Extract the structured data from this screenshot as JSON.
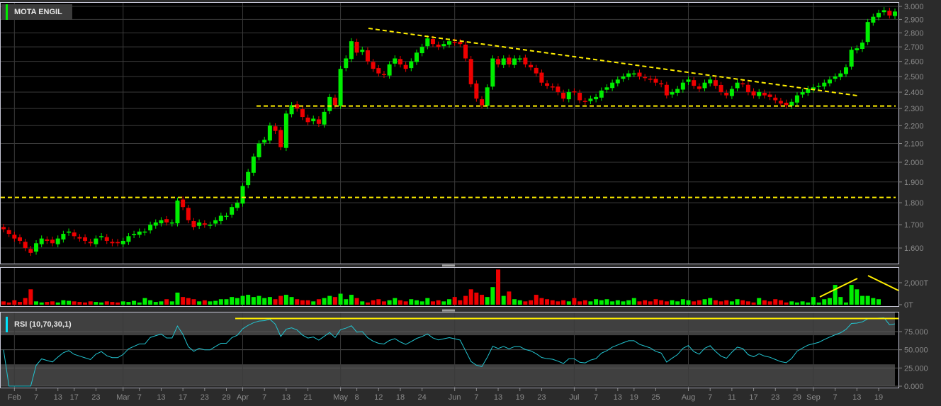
{
  "chart_data": {
    "type": "candlestick",
    "title": "MOTA ENGIL",
    "colors": {
      "up": "#00ee00",
      "down": "#ee0000",
      "trendline": "#ffee00",
      "rsi": "#22c4d0",
      "background": "#000000"
    },
    "price_axis": {
      "scale": "log",
      "ticks": [
        "3.000",
        "2.900",
        "2.800",
        "2.700",
        "2.600",
        "2.500",
        "2.400",
        "2.300",
        "2.200",
        "2.100",
        "2.000",
        "1.900",
        "1.800",
        "1.700",
        "1.600"
      ],
      "range": [
        1.56,
        3.02
      ]
    },
    "x_tick_labels": [
      "Feb",
      "7",
      "13",
      "17",
      "23",
      "Mar",
      "7",
      "13",
      "17",
      "23",
      "29",
      "Apr",
      "7",
      "13",
      "21",
      "May",
      "8",
      "12",
      "18",
      "24",
      "Jun",
      "7",
      "13",
      "19",
      "23",
      "Jul",
      "7",
      "13",
      "19",
      "25",
      "Aug",
      "7",
      "11",
      "17",
      "23",
      "29",
      "Sep",
      "7",
      "13",
      "19"
    ],
    "x_tick_index": [
      2,
      6,
      10,
      13,
      17,
      22,
      25,
      29,
      33,
      37,
      41,
      44,
      48,
      52,
      56,
      62,
      65,
      69,
      73,
      77,
      83,
      87,
      91,
      95,
      99,
      105,
      109,
      113,
      116,
      120,
      126,
      130,
      134,
      138,
      142,
      146,
      149,
      153,
      157,
      161
    ],
    "close": [
      1.68,
      1.66,
      1.64,
      1.63,
      1.6,
      1.58,
      1.62,
      1.64,
      1.63,
      1.62,
      1.64,
      1.66,
      1.67,
      1.65,
      1.64,
      1.63,
      1.62,
      1.64,
      1.65,
      1.63,
      1.62,
      1.62,
      1.63,
      1.65,
      1.66,
      1.67,
      1.67,
      1.7,
      1.71,
      1.72,
      1.71,
      1.71,
      1.81,
      1.78,
      1.72,
      1.69,
      1.71,
      1.7,
      1.7,
      1.72,
      1.74,
      1.74,
      1.78,
      1.8,
      1.88,
      1.95,
      2.03,
      2.1,
      2.12,
      2.2,
      2.17,
      2.08,
      2.27,
      2.32,
      2.3,
      2.25,
      2.22,
      2.24,
      2.21,
      2.28,
      2.37,
      2.32,
      2.55,
      2.62,
      2.74,
      2.66,
      2.68,
      2.6,
      2.55,
      2.52,
      2.51,
      2.58,
      2.62,
      2.58,
      2.55,
      2.6,
      2.66,
      2.7,
      2.76,
      2.72,
      2.7,
      2.72,
      2.74,
      2.73,
      2.72,
      2.62,
      2.45,
      2.36,
      2.32,
      2.43,
      2.62,
      2.58,
      2.62,
      2.58,
      2.62,
      2.62,
      2.58,
      2.56,
      2.52,
      2.46,
      2.44,
      2.43,
      2.4,
      2.36,
      2.4,
      2.4,
      2.35,
      2.34,
      2.36,
      2.37,
      2.41,
      2.43,
      2.46,
      2.48,
      2.5,
      2.52,
      2.52,
      2.5,
      2.49,
      2.48,
      2.46,
      2.45,
      2.38,
      2.4,
      2.42,
      2.46,
      2.48,
      2.44,
      2.42,
      2.46,
      2.48,
      2.44,
      2.4,
      2.38,
      2.42,
      2.46,
      2.45,
      2.4,
      2.38,
      2.4,
      2.38,
      2.37,
      2.35,
      2.33,
      2.32,
      2.34,
      2.38,
      2.4,
      2.42,
      2.43,
      2.44,
      2.46,
      2.48,
      2.5,
      2.52,
      2.56,
      2.68,
      2.69,
      2.73,
      2.88,
      2.92,
      2.95,
      2.97,
      2.93,
      2.96
    ],
    "volume_axis": {
      "ticks": [
        "2,000T",
        "0T"
      ],
      "unit": "T"
    },
    "volume": [
      300,
      200,
      400,
      250,
      600,
      1400,
      300,
      200,
      250,
      300,
      200,
      400,
      350,
      300,
      250,
      200,
      300,
      250,
      200,
      300,
      250,
      200,
      300,
      250,
      350,
      200,
      600,
      400,
      250,
      300,
      500,
      300,
      1100,
      700,
      600,
      500,
      300,
      400,
      300,
      350,
      500,
      500,
      700,
      600,
      800,
      900,
      700,
      800,
      600,
      700,
      500,
      800,
      900,
      700,
      500,
      400,
      400,
      300,
      500,
      600,
      800,
      700,
      1000,
      500,
      900,
      600,
      300,
      200,
      400,
      500,
      300,
      400,
      600,
      400,
      300,
      500,
      400,
      300,
      600,
      300,
      400,
      300,
      500,
      700,
      400,
      800,
      1400,
      1100,
      900,
      700,
      1600,
      3200,
      800,
      1200,
      500,
      400,
      300,
      400,
      900,
      600,
      500,
      400,
      300,
      400,
      300,
      600,
      300,
      400,
      300,
      500,
      400,
      500,
      300,
      400,
      300,
      400,
      600,
      300,
      400,
      300,
      500,
      400,
      300,
      400,
      300,
      500,
      400,
      300,
      400,
      500,
      600,
      400,
      300,
      400,
      300,
      500,
      400,
      300,
      200,
      600,
      400,
      300,
      500,
      400,
      200,
      300,
      200,
      300,
      200,
      700,
      200,
      500,
      600,
      1800,
      700,
      200,
      1800,
      1400,
      800,
      800,
      600,
      500
    ]
  },
  "rsi_panel": {
    "label": "RSI (10,70,30,1)",
    "ticks": [
      "75.000",
      "50.000",
      "25.000",
      "0.000"
    ],
    "period": 10,
    "overbought": 70,
    "oversold": 30,
    "reference_line": 93
  }
}
